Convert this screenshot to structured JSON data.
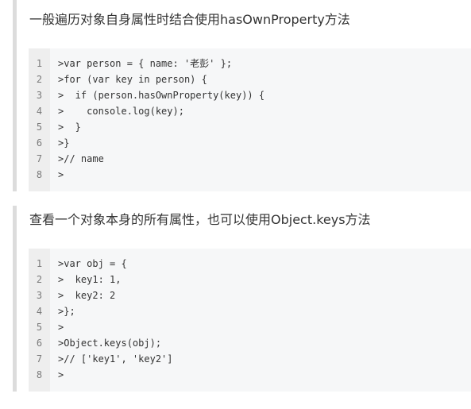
{
  "blocks": [
    {
      "heading": "一般遍历对象自身属性时结合使用hasOwnProperty方法",
      "lines": [
        {
          "num": "1",
          "code": ">var person = { name: '老彭' };"
        },
        {
          "num": "2",
          "code": ">for (var key in person) {"
        },
        {
          "num": "3",
          "code": ">  if (person.hasOwnProperty(key)) {"
        },
        {
          "num": "4",
          "code": ">    console.log(key);"
        },
        {
          "num": "5",
          "code": ">  }"
        },
        {
          "num": "6",
          "code": ">}"
        },
        {
          "num": "7",
          "code": ">// name"
        },
        {
          "num": "8",
          "code": ">"
        }
      ]
    },
    {
      "heading": "查看一个对象本身的所有属性，也可以使用Object.keys方法",
      "lines": [
        {
          "num": "1",
          "code": ">var obj = {"
        },
        {
          "num": "2",
          "code": ">  key1: 1,"
        },
        {
          "num": "3",
          "code": ">  key2: 2"
        },
        {
          "num": "4",
          "code": ">};"
        },
        {
          "num": "5",
          "code": ">"
        },
        {
          "num": "6",
          "code": ">Object.keys(obj);"
        },
        {
          "num": "7",
          "code": ">// ['key1', 'key2']"
        },
        {
          "num": "8",
          "code": ">"
        }
      ]
    }
  ]
}
